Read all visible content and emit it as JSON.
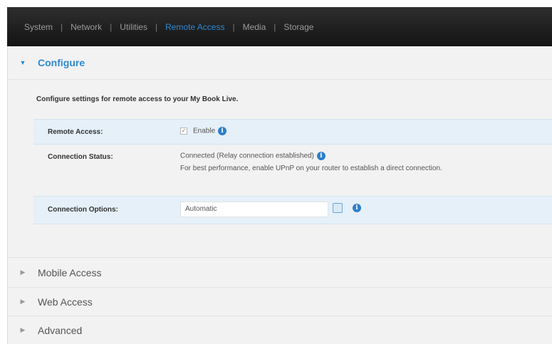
{
  "nav": {
    "tabs": [
      {
        "label": "System"
      },
      {
        "label": "Network"
      },
      {
        "label": "Utilities"
      },
      {
        "label": "Remote Access"
      },
      {
        "label": "Media"
      },
      {
        "label": "Storage"
      }
    ],
    "separator": "|",
    "active_tab": "Remote Access"
  },
  "configure": {
    "title": "Configure",
    "description": "Configure settings for remote access to your My Book Live.",
    "remote_access": {
      "label": "Remote Access:",
      "checkbox_label": "Enable",
      "checked": true
    },
    "connection_status": {
      "label": "Connection Status:",
      "value": "Connected (Relay connection established)",
      "note": "For best performance, enable UPnP on your router to establish a direct connection."
    },
    "connection_options": {
      "label": "Connection Options:",
      "selected": "Automatic"
    }
  },
  "sections": [
    {
      "title": "Mobile Access"
    },
    {
      "title": "Web Access"
    },
    {
      "title": "Advanced"
    }
  ],
  "icons": {
    "expanded": "▼",
    "collapsed": "▶",
    "info": "i",
    "check": "✓"
  },
  "colors": {
    "accent": "#2e89d4",
    "nav_bg": "#1c1c1c",
    "row_highlight": "#e5f0f8"
  }
}
